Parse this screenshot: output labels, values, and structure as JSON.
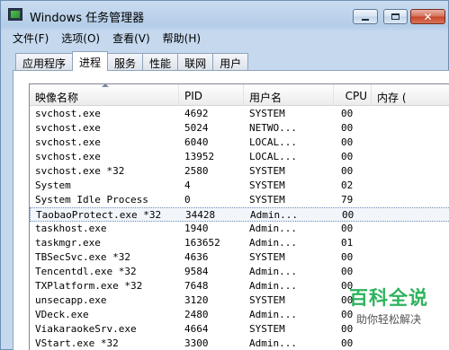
{
  "window": {
    "title": "Windows 任务管理器",
    "close_symbol": "✕"
  },
  "menu": [
    "文件(F)",
    "选项(O)",
    "查看(V)",
    "帮助(H)"
  ],
  "tabs": [
    "应用程序",
    "进程",
    "服务",
    "性能",
    "联网",
    "用户"
  ],
  "active_tab": "进程",
  "columns": [
    "映像名称",
    "PID",
    "用户名",
    "CPU",
    "内存 ("
  ],
  "processes": [
    {
      "name": "svchost.exe",
      "pid": "4692",
      "user": "SYSTEM",
      "cpu": "00"
    },
    {
      "name": "svchost.exe",
      "pid": "5024",
      "user": "NETWO...",
      "cpu": "00"
    },
    {
      "name": "svchost.exe",
      "pid": "6040",
      "user": "LOCAL...",
      "cpu": "00"
    },
    {
      "name": "svchost.exe",
      "pid": "13952",
      "user": "LOCAL...",
      "cpu": "00"
    },
    {
      "name": "svchost.exe *32",
      "pid": "2580",
      "user": "SYSTEM",
      "cpu": "00"
    },
    {
      "name": "System",
      "pid": "4",
      "user": "SYSTEM",
      "cpu": "02"
    },
    {
      "name": "System Idle Process",
      "pid": "0",
      "user": "SYSTEM",
      "cpu": "79"
    },
    {
      "name": "TaobaoProtect.exe *32",
      "pid": "34428",
      "user": "Admin...",
      "cpu": "00",
      "selected": true
    },
    {
      "name": "taskhost.exe",
      "pid": "1940",
      "user": "Admin...",
      "cpu": "00"
    },
    {
      "name": "taskmgr.exe",
      "pid": "163652",
      "user": "Admin...",
      "cpu": "01"
    },
    {
      "name": "TBSecSvc.exe *32",
      "pid": "4636",
      "user": "SYSTEM",
      "cpu": "00"
    },
    {
      "name": "Tencentdl.exe *32",
      "pid": "9584",
      "user": "Admin...",
      "cpu": "00"
    },
    {
      "name": "TXPlatform.exe *32",
      "pid": "7648",
      "user": "Admin...",
      "cpu": "00"
    },
    {
      "name": "unsecapp.exe",
      "pid": "3120",
      "user": "SYSTEM",
      "cpu": "00"
    },
    {
      "name": "VDeck.exe",
      "pid": "2480",
      "user": "Admin...",
      "cpu": "00"
    },
    {
      "name": "ViakaraokeSrv.exe",
      "pid": "4664",
      "user": "SYSTEM",
      "cpu": "00"
    },
    {
      "name": "VStart.exe *32",
      "pid": "3300",
      "user": "Admin...",
      "cpu": "00"
    }
  ],
  "watermark": {
    "title": "百科全说",
    "subtitle": "助你轻松解决"
  }
}
